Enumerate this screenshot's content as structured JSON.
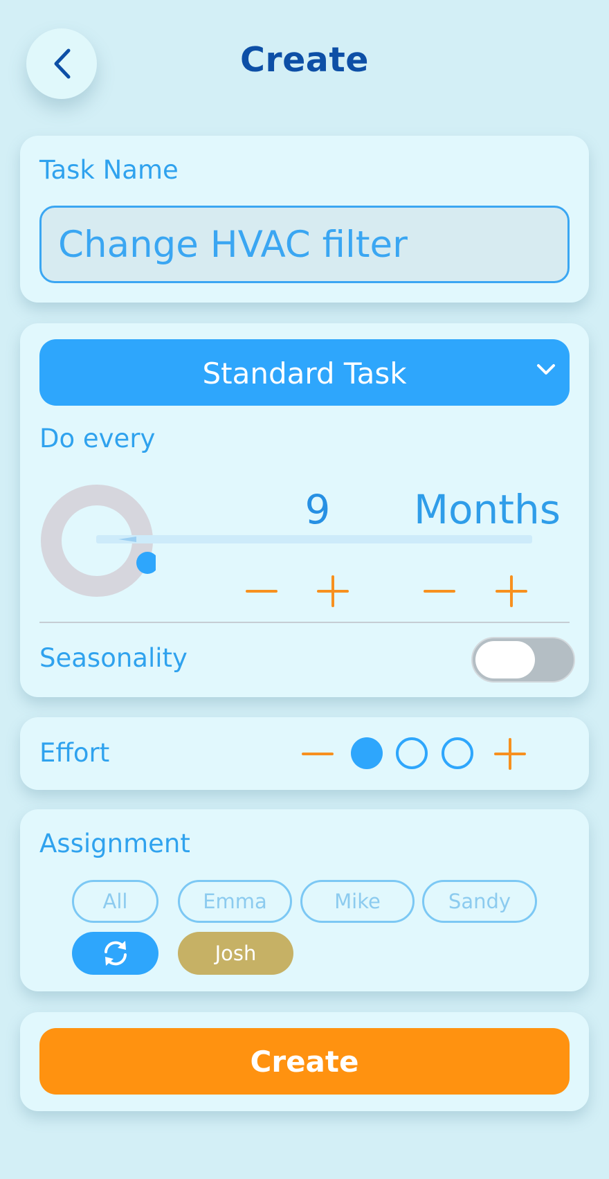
{
  "header": {
    "title": "Create",
    "back_icon": "chevron-left-icon"
  },
  "task_name": {
    "label": "Task Name",
    "placeholder": "Change HVAC filter",
    "value": ""
  },
  "schedule": {
    "task_type": "Standard Task",
    "do_every_label": "Do every",
    "interval_value": "9",
    "interval_unit": "Months",
    "seasonality_label": "Seasonality",
    "seasonality_enabled": false
  },
  "effort": {
    "label": "Effort",
    "level": 1,
    "max": 3
  },
  "assignment": {
    "label": "Assignment",
    "chips": [
      "All",
      "Emma",
      "Mike",
      "Sandy"
    ],
    "rotate_icon": "refresh-icon",
    "assignee": "Josh"
  },
  "actions": {
    "create_label": "Create"
  },
  "colors": {
    "background": "#d3eff6",
    "card": "#e1f8fd",
    "primary": "#2ea6fc",
    "accent": "#ff9210",
    "title": "#0d4fa6",
    "assignee_chip": "#c6b165"
  }
}
